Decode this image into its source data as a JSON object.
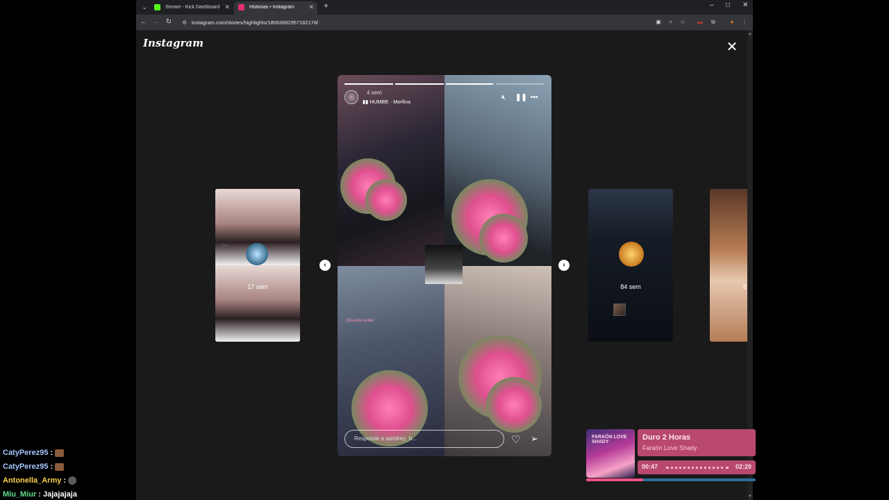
{
  "browser": {
    "tabs": [
      {
        "title": "Stream - Kick Dashboard",
        "favicon_color": "#53fc18"
      },
      {
        "title": "Historias • Instagram",
        "favicon_color": "#e1306c"
      }
    ],
    "url": "instagram.com/stories/highlights/18063692957182178/"
  },
  "instagram": {
    "logo": "Instagram",
    "story": {
      "time_ago": "4 sem",
      "music": "HUMBE · Morfina",
      "mention": "@la.alex.ander",
      "reply_placeholder": "Responde a aandrey_b...",
      "progress": {
        "segments": 4,
        "completed": 2,
        "current_fraction": 0.98
      }
    },
    "side_stories": [
      {
        "label": "17 sem",
        "inner_text": "OH,"
      },
      {
        "label": "84 sem"
      },
      {
        "label": "8"
      }
    ]
  },
  "chat": [
    {
      "user": "CatyPerez95",
      "color": "#a7c7ff",
      "emote": true
    },
    {
      "user": "CatyPerez95",
      "color": "#a7c7ff",
      "emote": true
    },
    {
      "user": "Antonella_Army",
      "color": "#ffd24d",
      "emote": true
    },
    {
      "user": "Miu_Miur",
      "color": "#5ee08a",
      "msg": "Jajajajaja"
    }
  ],
  "now_playing": {
    "title": "Duro 2 Horas",
    "artist": "Faraón Love Shady",
    "album_text": "FARAÓN LOVE SHADY",
    "current": "00:47",
    "duration": "02:20",
    "progress_fraction": 0.335
  }
}
